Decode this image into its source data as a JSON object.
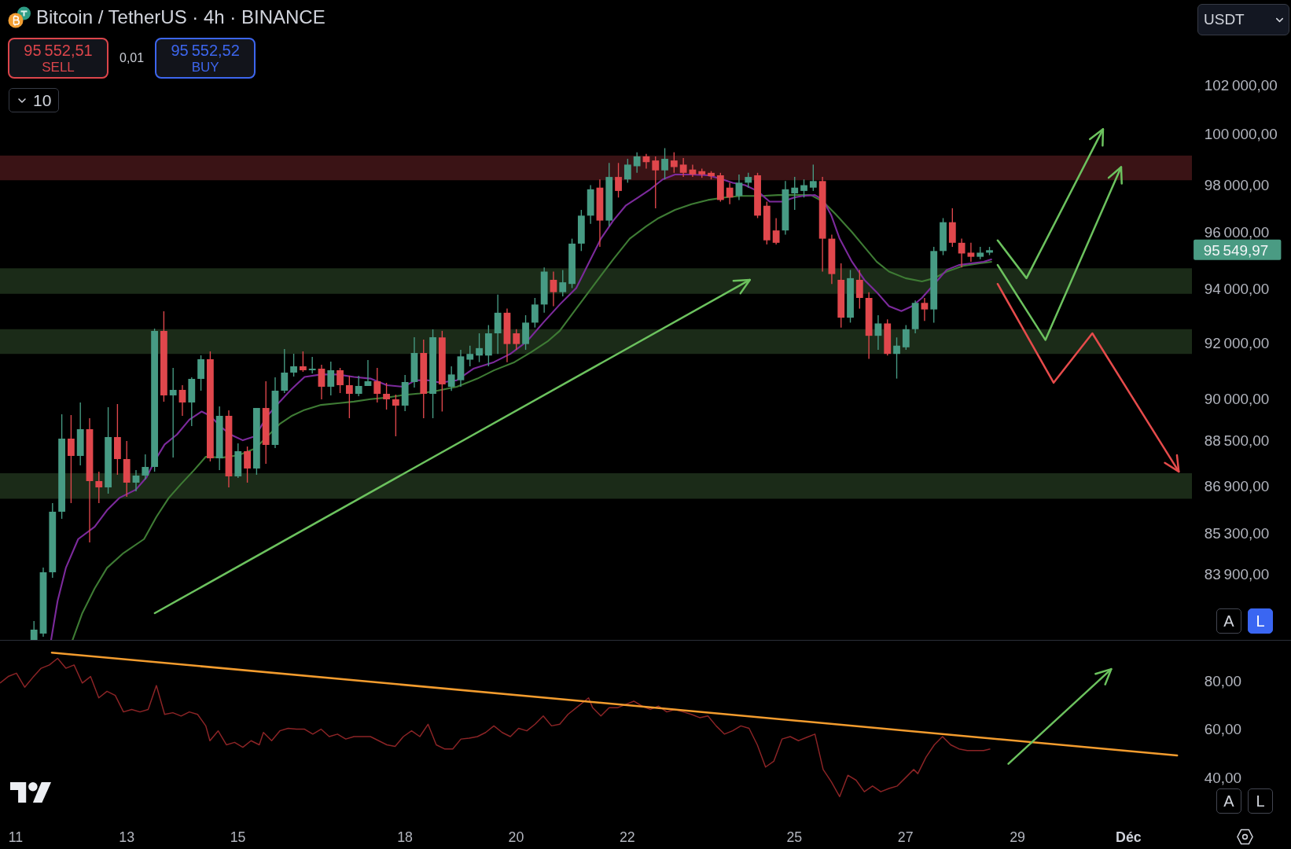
{
  "chart_header": {
    "title": "Bitcoin / TetherUS · 4h · BINANCE",
    "sell_button": {
      "price": "95 552,51",
      "label": "SELL"
    },
    "spread": "0,01",
    "buy_button": {
      "price": "95 552,52",
      "label": "BUY"
    },
    "quantity": "10"
  },
  "currency_dropdown": {
    "value": "USDT"
  },
  "price_axis": {
    "ticks": [
      "102 000,00",
      "100 000,00",
      "98 000,00",
      "96 000,00",
      "94 000,00",
      "92 000,00",
      "90 000,00",
      "88 500,00",
      "86 900,00",
      "85 300,00",
      "83 900,00"
    ],
    "current_price": "95 549,97"
  },
  "price_scale_buttons": [
    {
      "label": "A",
      "selected": false
    },
    {
      "label": "L",
      "selected": true
    }
  ],
  "oscillator_axis": {
    "ticks": [
      "80,00",
      "60,00",
      "40,00"
    ]
  },
  "oscillator_scale_buttons": [
    {
      "label": "A",
      "selected": false
    },
    {
      "label": "L",
      "selected": false
    }
  ],
  "time_axis": {
    "labels": [
      {
        "text": "11",
        "kind": "day"
      },
      {
        "text": "13",
        "kind": "day"
      },
      {
        "text": "15",
        "kind": "day"
      },
      {
        "text": "18",
        "kind": "day"
      },
      {
        "text": "20",
        "kind": "day"
      },
      {
        "text": "22",
        "kind": "day"
      },
      {
        "text": "25",
        "kind": "day"
      },
      {
        "text": "27",
        "kind": "day"
      },
      {
        "text": "29",
        "kind": "day"
      },
      {
        "text": "Déc",
        "kind": "month"
      }
    ]
  }
}
